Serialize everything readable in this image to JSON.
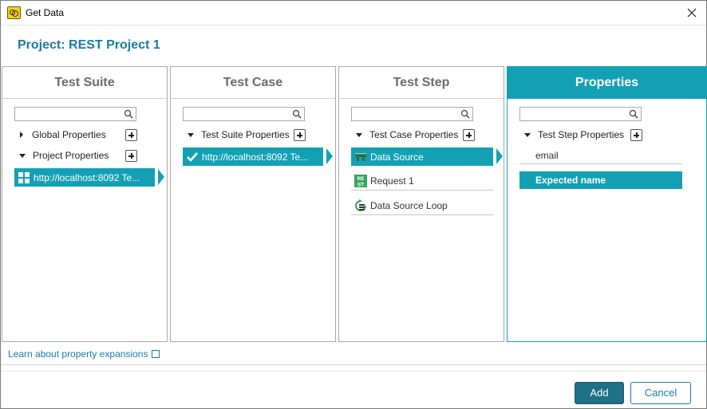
{
  "window": {
    "title": "Get Data"
  },
  "project": {
    "title": "Project: REST Project 1"
  },
  "columns": {
    "test_suite": {
      "header": "Test Suite",
      "search_placeholder": "",
      "tree": [
        {
          "label": "Global Properties",
          "expanded": false
        },
        {
          "label": "Project Properties",
          "expanded": true
        }
      ],
      "selected_item": "http://localhost:8092 Te..."
    },
    "test_case": {
      "header": "Test Case",
      "search_placeholder": "",
      "tree": [
        {
          "label": "Test Suite Properties",
          "expanded": true
        }
      ],
      "selected_item": "http://localhost:8092 Te..."
    },
    "test_step": {
      "header": "Test Step",
      "search_placeholder": "",
      "tree": [
        {
          "label": "Test Case Properties",
          "expanded": true
        }
      ],
      "items": [
        {
          "label": "Data Source",
          "selected": true,
          "icon": "data-source-icon"
        },
        {
          "label": "Request 1",
          "selected": false,
          "icon": "rest-request-icon"
        },
        {
          "label": "Data Source Loop",
          "selected": false,
          "icon": "data-source-loop-icon"
        }
      ]
    },
    "properties": {
      "header": "Properties",
      "search_placeholder": "",
      "tree": [
        {
          "label": "Test Step Properties",
          "expanded": true
        }
      ],
      "items": [
        {
          "label": "email",
          "selected": false
        },
        {
          "label": "Expected name",
          "selected": true
        }
      ]
    }
  },
  "footer": {
    "learn_link": "Learn about property expansions",
    "add_label": "Add",
    "cancel_label": "Cancel"
  },
  "colors": {
    "accent": "#14a0b4",
    "link": "#1d7aa3",
    "add_button": "#1e7186"
  }
}
